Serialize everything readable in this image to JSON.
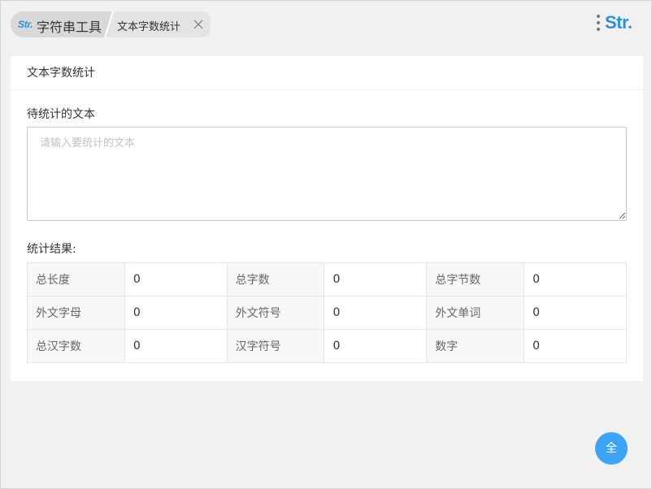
{
  "breadcrumb": {
    "home_logo": "Str.",
    "home_label": "字符串工具",
    "current_label": "文本字数统计"
  },
  "brand": {
    "text": "Str."
  },
  "card": {
    "title": "文本字数统计",
    "input_label": "待统计的文本",
    "input_placeholder": "请输入要统计的文本",
    "input_value": "",
    "result_label": "统计结果:"
  },
  "stats": [
    [
      {
        "label": "总长度",
        "value": "0"
      },
      {
        "label": "总字数",
        "value": "0"
      },
      {
        "label": "总字节数",
        "value": "0"
      }
    ],
    [
      {
        "label": "外文字母",
        "value": "0"
      },
      {
        "label": "外文符号",
        "value": "0"
      },
      {
        "label": "外文单词",
        "value": "0"
      }
    ],
    [
      {
        "label": "总汉字数",
        "value": "0"
      },
      {
        "label": "汉字符号",
        "value": "0"
      },
      {
        "label": "数字",
        "value": "0"
      }
    ]
  ],
  "fab": {
    "label": "全"
  },
  "colors": {
    "accent": "#2f8fd8",
    "fab": "#3ea4f5",
    "page_bg": "#f1f1f1",
    "card_bg": "#ffffff"
  },
  "icons": {
    "close": "close-icon",
    "brand_menu": "vertical-dots-icon",
    "resize": "resize-grip-icon"
  }
}
